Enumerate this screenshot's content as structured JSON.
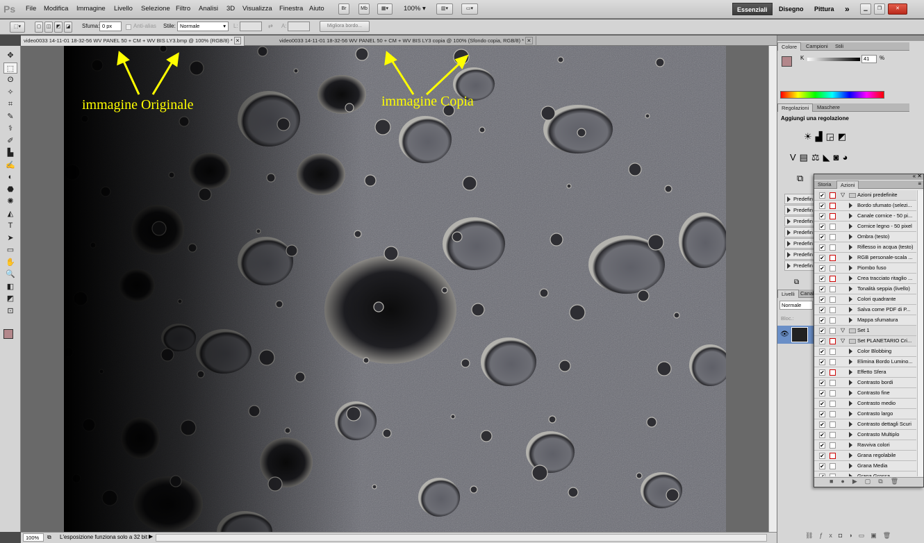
{
  "app": {
    "logo": "Ps"
  },
  "menu": [
    "File",
    "Modifica",
    "Immagine",
    "Livello",
    "Selezione",
    "Filtro",
    "Analisi",
    "3D",
    "Visualizza",
    "Finestra",
    "Aiuto"
  ],
  "appbar": {
    "br": "Br",
    "mb": "Mb",
    "zoom": "100%"
  },
  "workspaces": {
    "active": "Essenziali",
    "w2": "Disegno",
    "w3": "Pittura",
    "more": "»"
  },
  "options": {
    "sfuma_label": "Sfuma:",
    "sfuma_value": "0 px",
    "antialias": "Anti-alias",
    "stile_label": "Stile:",
    "stile_value": "Normale",
    "l_label": "L:",
    "a_label": "A:",
    "migliora": "Migliora bordo..."
  },
  "tabs": [
    "video0033 14-11-01 18-32-56 WV PANEL 50 + CM + WV BIS LY3.bmp @ 100% (RGB/8) *",
    "video0033 14-11-01 18-32-56 WV PANEL 50 + CM + WV BIS LY3 copia @ 100% (Sfondo copia, RGB/8) *"
  ],
  "annotations": {
    "left": "immagine Originale",
    "right": "immagine Copia"
  },
  "status": {
    "zoom": "100%",
    "message": "L'esposizione funziona solo a 32 bit"
  },
  "color_panel": {
    "tabs": [
      "Colore",
      "Campioni",
      "Stili"
    ],
    "k_label": "K",
    "k_value": "41",
    "unit": "%"
  },
  "adjust_panel": {
    "tabs": [
      "Regolazioni",
      "Maschere"
    ],
    "title": "Aggiungi una regolazione",
    "presets": [
      "Predefin",
      "Predefin",
      "Predefin",
      "Predefin",
      "Predefin",
      "Predefin",
      "Predefin"
    ]
  },
  "layers_panel": {
    "tabs": [
      "Livelli",
      "Canali"
    ],
    "blend": "Normale",
    "lock": "Bloc.:"
  },
  "actions_panel": {
    "tabs": [
      "Storia",
      "Azioni"
    ],
    "rows": [
      {
        "label": "Azioni predefinite",
        "type": "set",
        "red": true
      },
      {
        "label": "Bordo sfumato (selezi...",
        "type": "action",
        "red": true
      },
      {
        "label": "Canale cornice - 50 pi...",
        "type": "action",
        "red": true
      },
      {
        "label": "Cornice legno - 50 pixel",
        "type": "action",
        "red": false
      },
      {
        "label": "Ombra (testo)",
        "type": "action",
        "red": false
      },
      {
        "label": "Riflesso in acqua (testo)",
        "type": "action",
        "red": false
      },
      {
        "label": "RGB personale-scala ...",
        "type": "action",
        "red": true
      },
      {
        "label": "Piombo fuso",
        "type": "action",
        "red": false
      },
      {
        "label": "Crea tracciato ritaglio ...",
        "type": "action",
        "red": true
      },
      {
        "label": "Tonalità seppia (livello)",
        "type": "action",
        "red": false
      },
      {
        "label": "Colori quadrante",
        "type": "action",
        "red": false
      },
      {
        "label": "Salva come PDF di P...",
        "type": "action",
        "red": false
      },
      {
        "label": "Mappa sfumatura",
        "type": "action",
        "red": false
      },
      {
        "label": "Set 1",
        "type": "set",
        "red": false
      },
      {
        "label": "Set PLANETARIO Cri...",
        "type": "set",
        "red": true
      },
      {
        "label": "Color Blobbing",
        "type": "action",
        "red": false
      },
      {
        "label": "Elimina Bordo Lumino...",
        "type": "action",
        "red": false
      },
      {
        "label": "Effetto Sfera",
        "type": "action",
        "red": true
      },
      {
        "label": "Contrasto bordi",
        "type": "action",
        "red": false
      },
      {
        "label": "Contrasto fine",
        "type": "action",
        "red": false
      },
      {
        "label": "Contrasto medio",
        "type": "action",
        "red": false
      },
      {
        "label": "Contrasto largo",
        "type": "action",
        "red": false
      },
      {
        "label": "Contrasto dettagli Scuri",
        "type": "action",
        "red": false
      },
      {
        "label": "Contrasto Multiplo",
        "type": "action",
        "red": false
      },
      {
        "label": "Ravviva colori",
        "type": "action",
        "red": false
      },
      {
        "label": "Grana regolabile",
        "type": "action",
        "red": true
      },
      {
        "label": "Grana Media",
        "type": "action",
        "red": false
      },
      {
        "label": "Grana Grossa",
        "type": "action",
        "red": false
      }
    ]
  }
}
